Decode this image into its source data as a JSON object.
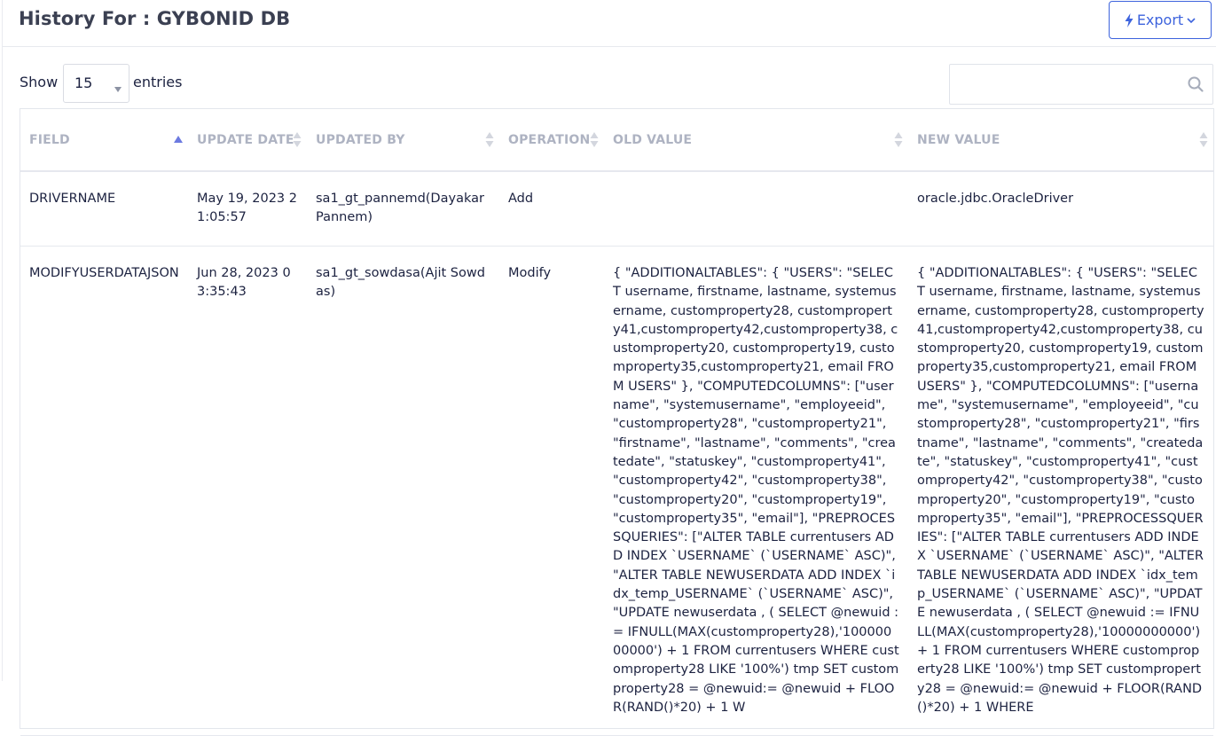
{
  "header": {
    "title": "History For : GYBONID DB",
    "export_label": "Export",
    "export_icon": "bolt-icon",
    "export_caret": "chevron-down-icon"
  },
  "controls": {
    "show_label": "Show",
    "entries_value": "15",
    "entries_label": "entries",
    "search_value": "",
    "search_icon": "search-icon"
  },
  "colors": {
    "accent": "#3d63dd",
    "header_text": "#aeb3c2",
    "body_text": "#1c2240"
  },
  "table": {
    "columns": [
      {
        "label": "FIELD",
        "sort": "asc"
      },
      {
        "label": "UPDATE DATE",
        "sort": "none"
      },
      {
        "label": "UPDATED BY",
        "sort": "none"
      },
      {
        "label": "OPERATION",
        "sort": "none"
      },
      {
        "label": "OLD VALUE",
        "sort": "none"
      },
      {
        "label": "NEW VALUE",
        "sort": "none"
      }
    ],
    "rows": [
      {
        "field": "DRIVERNAME",
        "update_date": "May 19, 2023 21:05:57",
        "updated_by": "sa1_gt_pannemd(Dayakar Pannem)",
        "operation": "Add",
        "old_value": "",
        "new_value": "oracle.jdbc.OracleDriver"
      },
      {
        "field": "MODIFYUSERDATAJSON",
        "update_date": "Jun 28, 2023 03:35:43",
        "updated_by": "sa1_gt_sowdasa(Ajit Sowdas)",
        "operation": "Modify",
        "old_value": "{ \"ADDITIONALTABLES\": { \"USERS\": \"SELECT username, firstname, lastname, systemusername, customproperty28, customproperty41,customproperty42,customproperty38, customproperty20, customproperty19, customproperty35,customproperty21, email FROM USERS\" }, \"COMPUTEDCOLUMNS\": [\"username\", \"systemusername\", \"employeeid\", \"customproperty28\", \"customproperty21\", \"firstname\", \"lastname\", \"comments\", \"createdate\", \"statuskey\", \"customproperty41\", \"customproperty42\", \"customproperty38\", \"customproperty20\", \"customproperty19\", \"customproperty35\", \"email\"], \"PREPROCESSQUERIES\": [\"ALTER TABLE currentusers ADD INDEX `USERNAME` (`USERNAME` ASC)\", \"ALTER TABLE NEWUSERDATA ADD INDEX `idx_temp_USERNAME` (`USERNAME` ASC)\", \"UPDATE newuserdata , ( SELECT @newuid := IFNULL(MAX(customproperty28),'10000000000') + 1 FROM currentusers WHERE customproperty28 LIKE '100%') tmp SET customproperty28 = @newuid:= @newuid + FLOOR(RAND()*20) + 1 W",
        "new_value": "{ \"ADDITIONALTABLES\": { \"USERS\": \"SELECT username, firstname, lastname, systemusername, customproperty28, customproperty41,customproperty42,customproperty38, customproperty20, customproperty19, customproperty35,customproperty21, email FROM USERS\" }, \"COMPUTEDCOLUMNS\": [\"username\", \"systemusername\", \"employeeid\", \"customproperty28\", \"customproperty21\", \"firstname\", \"lastname\", \"comments\", \"createdate\", \"statuskey\", \"customproperty41\", \"customproperty42\", \"customproperty38\", \"customproperty20\", \"customproperty19\", \"customproperty35\", \"email\"], \"PREPROCESSQUERIES\": [\"ALTER TABLE currentusers ADD INDEX `USERNAME` (`USERNAME` ASC)\", \"ALTER TABLE NEWUSERDATA ADD INDEX `idx_temp_USERNAME` (`USERNAME` ASC)\", \"UPDATE newuserdata , ( SELECT @newuid := IFNULL(MAX(customproperty28),'10000000000') + 1 FROM currentusers WHERE customproperty28 LIKE '100%') tmp SET customproperty28 = @newuid:= @newuid + FLOOR(RAND()*20) + 1 WHERE"
      }
    ]
  }
}
